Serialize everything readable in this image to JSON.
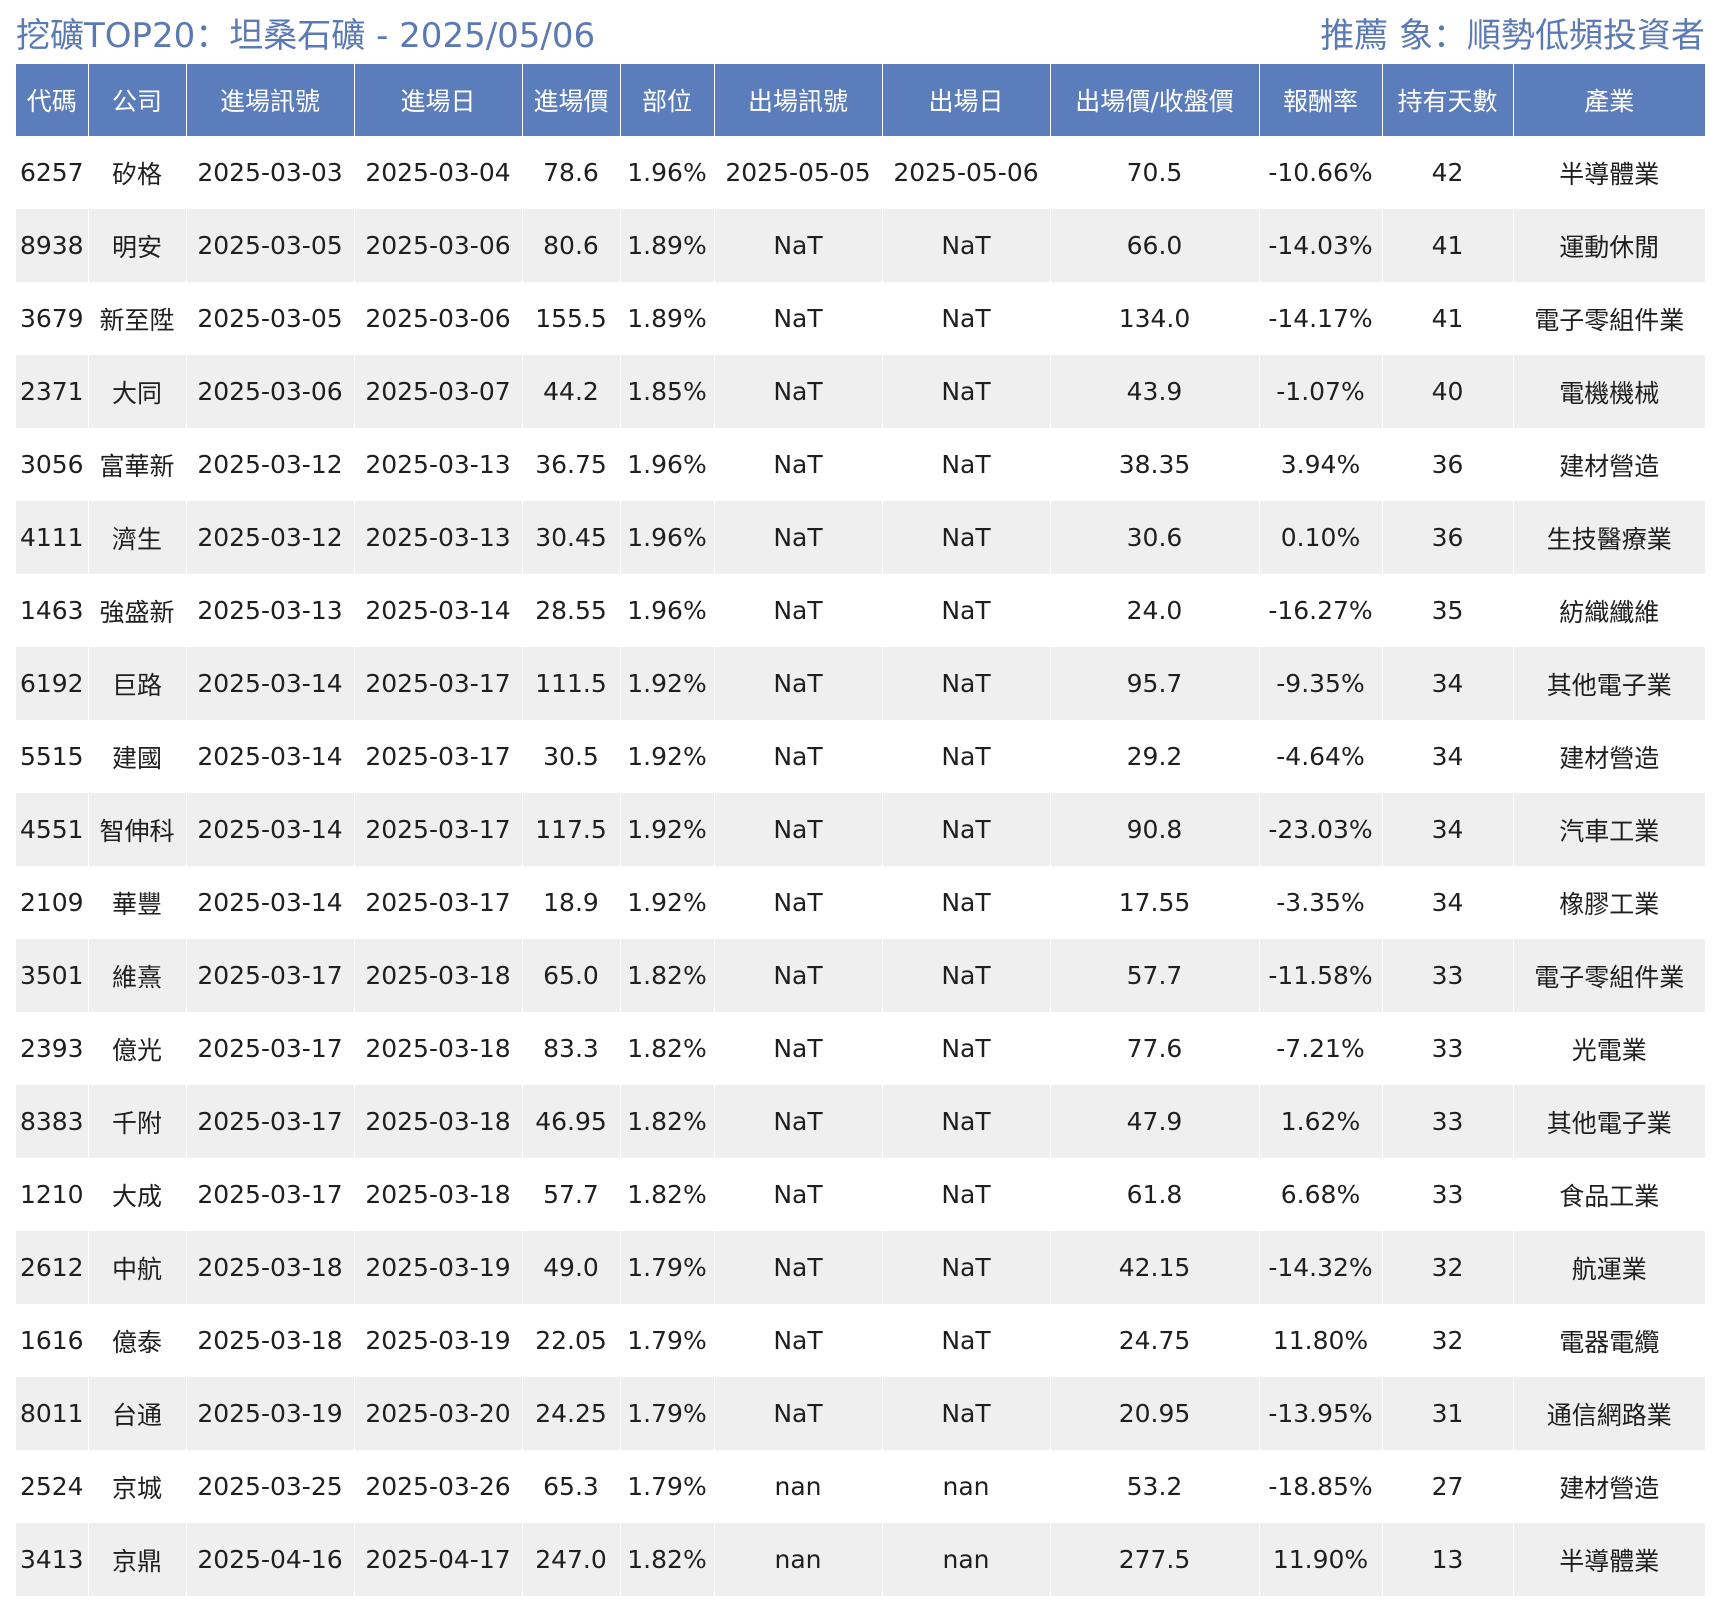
{
  "header": {
    "title": "挖礦TOP20：坦桑石礦 - 2025/05/06",
    "audience": "推薦 象：順勢低頻投資者"
  },
  "table": {
    "columns": [
      "代碼",
      "公司",
      "進場訊號",
      "進場日",
      "進場價",
      "部位",
      "出場訊號",
      "出場日",
      "出場價/收盤價",
      "報酬率",
      "持有天數",
      "產業"
    ],
    "rows": [
      [
        "6257",
        "矽格",
        "2025-03-03",
        "2025-03-04",
        "78.6",
        "1.96%",
        "2025-05-05",
        "2025-05-06",
        "70.5",
        "-10.66%",
        "42",
        "半導體業"
      ],
      [
        "8938",
        "明安",
        "2025-03-05",
        "2025-03-06",
        "80.6",
        "1.89%",
        "NaT",
        "NaT",
        "66.0",
        "-14.03%",
        "41",
        "運動休閒"
      ],
      [
        "3679",
        "新至陞",
        "2025-03-05",
        "2025-03-06",
        "155.5",
        "1.89%",
        "NaT",
        "NaT",
        "134.0",
        "-14.17%",
        "41",
        "電子零組件業"
      ],
      [
        "2371",
        "大同",
        "2025-03-06",
        "2025-03-07",
        "44.2",
        "1.85%",
        "NaT",
        "NaT",
        "43.9",
        "-1.07%",
        "40",
        "電機機械"
      ],
      [
        "3056",
        "富華新",
        "2025-03-12",
        "2025-03-13",
        "36.75",
        "1.96%",
        "NaT",
        "NaT",
        "38.35",
        "3.94%",
        "36",
        "建材營造"
      ],
      [
        "4111",
        "濟生",
        "2025-03-12",
        "2025-03-13",
        "30.45",
        "1.96%",
        "NaT",
        "NaT",
        "30.6",
        "0.10%",
        "36",
        "生技醫療業"
      ],
      [
        "1463",
        "強盛新",
        "2025-03-13",
        "2025-03-14",
        "28.55",
        "1.96%",
        "NaT",
        "NaT",
        "24.0",
        "-16.27%",
        "35",
        "紡織纖維"
      ],
      [
        "6192",
        "巨路",
        "2025-03-14",
        "2025-03-17",
        "111.5",
        "1.92%",
        "NaT",
        "NaT",
        "95.7",
        "-9.35%",
        "34",
        "其他電子業"
      ],
      [
        "5515",
        "建國",
        "2025-03-14",
        "2025-03-17",
        "30.5",
        "1.92%",
        "NaT",
        "NaT",
        "29.2",
        "-4.64%",
        "34",
        "建材營造"
      ],
      [
        "4551",
        "智伸科",
        "2025-03-14",
        "2025-03-17",
        "117.5",
        "1.92%",
        "NaT",
        "NaT",
        "90.8",
        "-23.03%",
        "34",
        "汽車工業"
      ],
      [
        "2109",
        "華豐",
        "2025-03-14",
        "2025-03-17",
        "18.9",
        "1.92%",
        "NaT",
        "NaT",
        "17.55",
        "-3.35%",
        "34",
        "橡膠工業"
      ],
      [
        "3501",
        "維熹",
        "2025-03-17",
        "2025-03-18",
        "65.0",
        "1.82%",
        "NaT",
        "NaT",
        "57.7",
        "-11.58%",
        "33",
        "電子零組件業"
      ],
      [
        "2393",
        "億光",
        "2025-03-17",
        "2025-03-18",
        "83.3",
        "1.82%",
        "NaT",
        "NaT",
        "77.6",
        "-7.21%",
        "33",
        "光電業"
      ],
      [
        "8383",
        "千附",
        "2025-03-17",
        "2025-03-18",
        "46.95",
        "1.82%",
        "NaT",
        "NaT",
        "47.9",
        "1.62%",
        "33",
        "其他電子業"
      ],
      [
        "1210",
        "大成",
        "2025-03-17",
        "2025-03-18",
        "57.7",
        "1.82%",
        "NaT",
        "NaT",
        "61.8",
        "6.68%",
        "33",
        "食品工業"
      ],
      [
        "2612",
        "中航",
        "2025-03-18",
        "2025-03-19",
        "49.0",
        "1.79%",
        "NaT",
        "NaT",
        "42.15",
        "-14.32%",
        "32",
        "航運業"
      ],
      [
        "1616",
        "億泰",
        "2025-03-18",
        "2025-03-19",
        "22.05",
        "1.79%",
        "NaT",
        "NaT",
        "24.75",
        "11.80%",
        "32",
        "電器電纜"
      ],
      [
        "8011",
        "台通",
        "2025-03-19",
        "2025-03-20",
        "24.25",
        "1.79%",
        "NaT",
        "NaT",
        "20.95",
        "-13.95%",
        "31",
        "通信網路業"
      ],
      [
        "2524",
        "京城",
        "2025-03-25",
        "2025-03-26",
        "65.3",
        "1.79%",
        "nan",
        "nan",
        "53.2",
        "-18.85%",
        "27",
        "建材營造"
      ],
      [
        "3413",
        "京鼎",
        "2025-04-16",
        "2025-04-17",
        "247.0",
        "1.82%",
        "nan",
        "nan",
        "277.5",
        "11.90%",
        "13",
        "半導體業"
      ]
    ]
  }
}
